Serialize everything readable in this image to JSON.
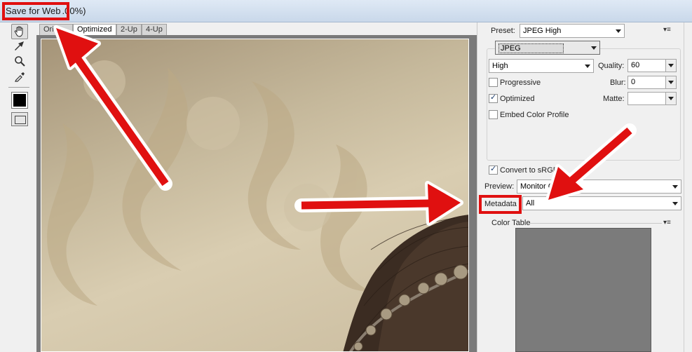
{
  "window": {
    "title": "Save for Web",
    "title_rest": ".00%)"
  },
  "toolbox": {
    "tools": [
      {
        "icon": "hand-tool-icon"
      },
      {
        "icon": "slice-select-icon"
      },
      {
        "icon": "zoom-icon"
      },
      {
        "icon": "eyedropper-icon"
      },
      {
        "icon": "eyedropper-color-swatch"
      },
      {
        "icon": "toggle-slices-icon"
      }
    ]
  },
  "tabs": [
    {
      "label": "Ori"
    },
    {
      "label": "Optimized"
    },
    {
      "label": "2-Up"
    },
    {
      "label": "4-Up"
    }
  ],
  "settings": {
    "preset_label": "Preset:",
    "preset_value": "JPEG High",
    "format_value": "JPEG",
    "quality_preset": "High",
    "quality_label": "Quality:",
    "quality_value": "60",
    "progressive_label": "Progressive",
    "progressive_checked": false,
    "blur_label": "Blur:",
    "blur_value": "0",
    "optimized_label": "Optimized",
    "optimized_checked": true,
    "matte_label": "Matte:",
    "matte_value": "",
    "embed_profile_label": "Embed Color Profile",
    "embed_profile_checked": false,
    "convert_srgb_label": "Convert to sRGB",
    "convert_srgb_checked": true,
    "preview_label": "Preview:",
    "preview_value": "Monitor C",
    "metadata_label": "Metadata",
    "metadata_value": "All"
  },
  "color_table": {
    "title": "Color Table"
  },
  "colors": {
    "annotation": "#e01010",
    "titlebar": "#dfe9f5"
  }
}
